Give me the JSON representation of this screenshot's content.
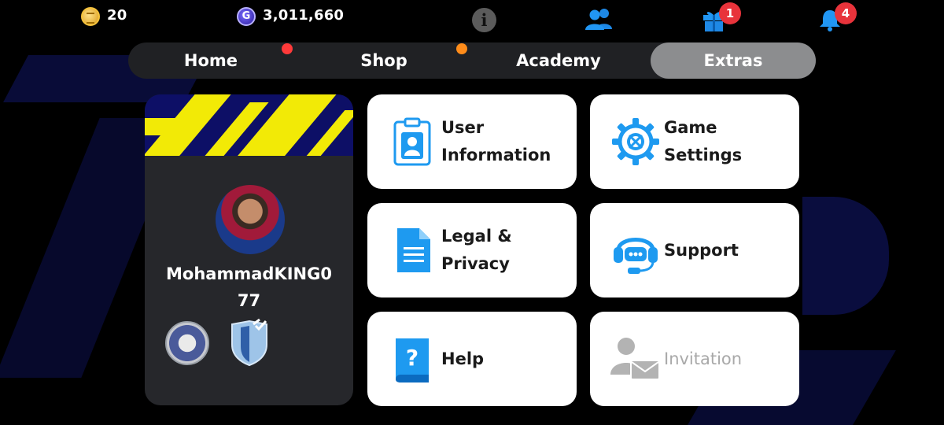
{
  "currency": {
    "coins": "20",
    "gp": "3,011,660",
    "gp_symbol": "G"
  },
  "top_icons": {
    "info": "i",
    "gift_badge": "1",
    "notification_badge": "4"
  },
  "tabs": [
    {
      "label": "Home",
      "active": false
    },
    {
      "label": "Shop",
      "active": false
    },
    {
      "label": "Academy",
      "active": false
    },
    {
      "label": "Extras",
      "active": true
    }
  ],
  "profile": {
    "name": "MohammadKING0",
    "level": "77"
  },
  "menu": [
    {
      "line1": "User",
      "line2": "Information",
      "icon": "user-info-icon"
    },
    {
      "line1": "Game",
      "line2": "Settings",
      "icon": "gear-icon"
    },
    {
      "line1": "Legal &",
      "line2": "Privacy",
      "icon": "document-icon"
    },
    {
      "line1": "Support",
      "line2": "",
      "icon": "headset-icon"
    },
    {
      "line1": "Help",
      "line2": "",
      "icon": "help-book-icon"
    },
    {
      "line1": "Invitation",
      "line2": "",
      "icon": "invite-mail-icon"
    }
  ],
  "colors": {
    "accent_blue": "#1e9af0",
    "badge_red": "#e8333b",
    "active_tab": "#8c8d8f"
  }
}
